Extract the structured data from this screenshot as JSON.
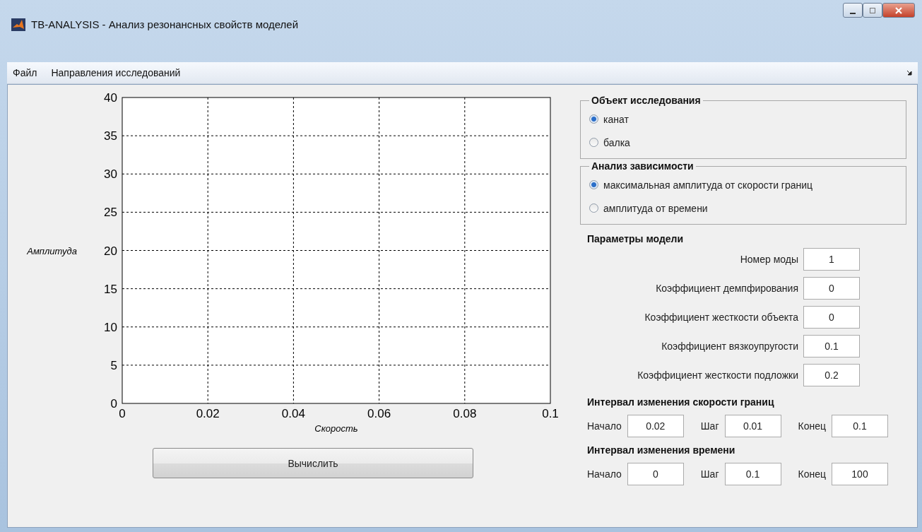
{
  "window": {
    "title": "TB-ANALYSIS - Анализ резонансных свойств моделей"
  },
  "menu": [
    {
      "label": "Файл"
    },
    {
      "label": "Направления исследований"
    }
  ],
  "plot": {
    "chart_data": {
      "type": "line",
      "grid": true,
      "xlabel": "Скорость",
      "ylabel": "Амплитуда",
      "xlim": [
        0,
        0.1
      ],
      "ylim": [
        0,
        40
      ],
      "xticks": [
        {
          "value": 0,
          "label": "0"
        },
        {
          "value": 0.02,
          "label": "0.02"
        },
        {
          "value": 0.04,
          "label": "0.04"
        },
        {
          "value": 0.06,
          "label": "0.06"
        },
        {
          "value": 0.08,
          "label": "0.08"
        },
        {
          "value": 0.1,
          "label": "0.1"
        }
      ],
      "yticks": [
        {
          "value": 0,
          "label": "0"
        },
        {
          "value": 5,
          "label": "5"
        },
        {
          "value": 10,
          "label": "10"
        },
        {
          "value": 15,
          "label": "15"
        },
        {
          "value": 20,
          "label": "20"
        },
        {
          "value": 25,
          "label": "25"
        },
        {
          "value": 30,
          "label": "30"
        },
        {
          "value": 35,
          "label": "35"
        },
        {
          "value": 40,
          "label": "40"
        }
      ]
    }
  },
  "compute_button": "Вычислить",
  "groups": [
    {
      "title": "Объект исследования",
      "options": [
        {
          "label": "канат",
          "selected": true
        },
        {
          "label": "балка",
          "selected": false
        }
      ]
    },
    {
      "title": "Анализ зависимости",
      "options": [
        {
          "label": "максимальная амплитуда от скорости границ",
          "selected": true
        },
        {
          "label": "амплитуда от времени",
          "selected": false
        }
      ]
    }
  ],
  "model_params": {
    "title": "Параметры модели",
    "fields": [
      {
        "label": "Номер моды",
        "value": "1"
      },
      {
        "label": "Коэффициент демпфирования",
        "value": "0"
      },
      {
        "label": "Коэффициент жесткости объекта",
        "value": "0"
      },
      {
        "label": "Коэффициент вязкоупругости",
        "value": "0.1"
      },
      {
        "label": "Коэффициент жесткости подложки",
        "value": "0.2"
      }
    ]
  },
  "intervals": [
    {
      "title": "Интервал изменения скорости границ",
      "fields": [
        {
          "label": "Начало",
          "value": "0.02"
        },
        {
          "label": "Шаг",
          "value": "0.01"
        },
        {
          "label": "Конец",
          "value": "0.1"
        }
      ]
    },
    {
      "title": "Интервал изменения времени",
      "fields": [
        {
          "label": "Начало",
          "value": "0"
        },
        {
          "label": "Шаг",
          "value": "0.1"
        },
        {
          "label": "Конец",
          "value": "100"
        }
      ]
    }
  ]
}
